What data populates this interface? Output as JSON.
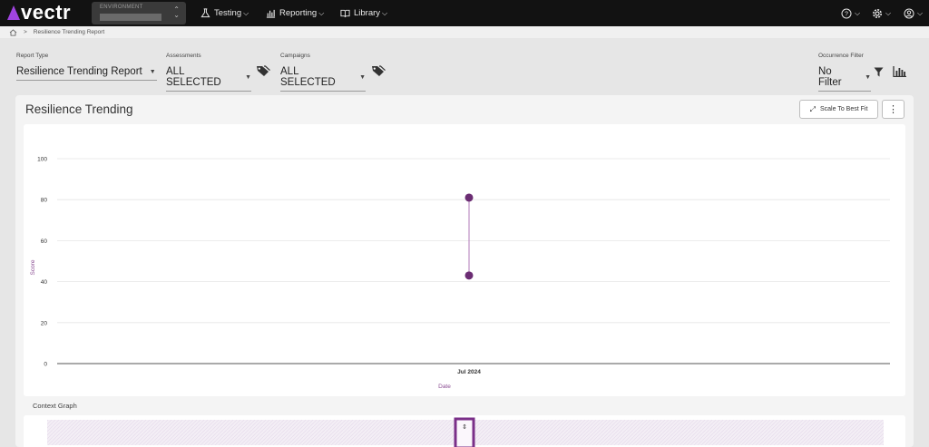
{
  "nav": {
    "logo_text": "vectr",
    "environment_label": "ENVIRONMENT",
    "items": [
      {
        "label": "Testing",
        "icon": "flask-icon"
      },
      {
        "label": "Reporting",
        "icon": "bar-chart-icon"
      },
      {
        "label": "Library",
        "icon": "book-icon"
      }
    ],
    "right_icons": [
      "help-icon",
      "gear-icon",
      "user-icon"
    ]
  },
  "breadcrumb": {
    "home_icon": "home-icon",
    "current": "Resilience Trending Report"
  },
  "filters": {
    "report_type": {
      "label": "Report Type",
      "value": "Resilience Trending Report"
    },
    "assessments": {
      "label": "Assessments",
      "value": "ALL SELECTED"
    },
    "campaigns": {
      "label": "Campaigns",
      "value": "ALL SELECTED"
    },
    "occurrence": {
      "label": "Occurrence Filter",
      "value": "No Filter"
    }
  },
  "panel": {
    "title": "Resilience Trending",
    "scale_button": "Scale To Best Fit",
    "more_button": "⋮",
    "context_label": "Context Graph"
  },
  "colors": {
    "accent": "#6b2d73",
    "brand": "#a044e0",
    "topbar": "#121212"
  },
  "chart_data": {
    "type": "scatter",
    "xlabel": "Date",
    "ylabel": "Score",
    "ylim": [
      0,
      100
    ],
    "yticks": [
      0,
      20,
      40,
      60,
      80,
      100
    ],
    "xticks": [
      "Jul 2024"
    ],
    "grid": true,
    "series": [
      {
        "x": [
          "Jul 2024",
          "Jul 2024"
        ],
        "y": [
          81,
          43
        ],
        "connected": true
      }
    ]
  }
}
